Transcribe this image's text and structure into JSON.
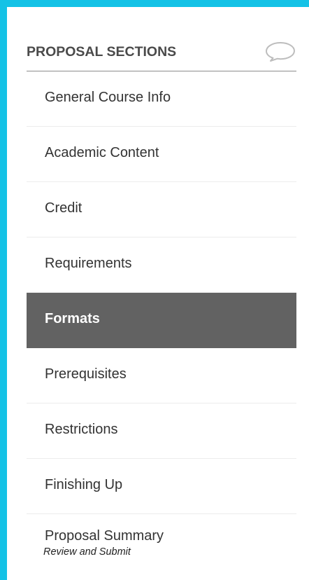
{
  "sidebar": {
    "title": "PROPOSAL SECTIONS",
    "comment_icon": "speech-bubble-icon",
    "items": [
      {
        "label": "General Course Info",
        "active": false
      },
      {
        "label": "Academic Content",
        "active": false
      },
      {
        "label": "Credit",
        "active": false
      },
      {
        "label": "Requirements",
        "active": false
      },
      {
        "label": "Formats",
        "active": true
      },
      {
        "label": "Prerequisites",
        "active": false
      },
      {
        "label": "Restrictions",
        "active": false
      },
      {
        "label": "Finishing Up",
        "active": false
      },
      {
        "label": "Proposal Summary",
        "sublabel": "Review and Submit",
        "active": false
      }
    ]
  },
  "colors": {
    "frame_border": "#14c2e6",
    "active_bg": "#626262",
    "active_text": "#ffffff",
    "text": "#333333",
    "divider": "#ececec"
  }
}
